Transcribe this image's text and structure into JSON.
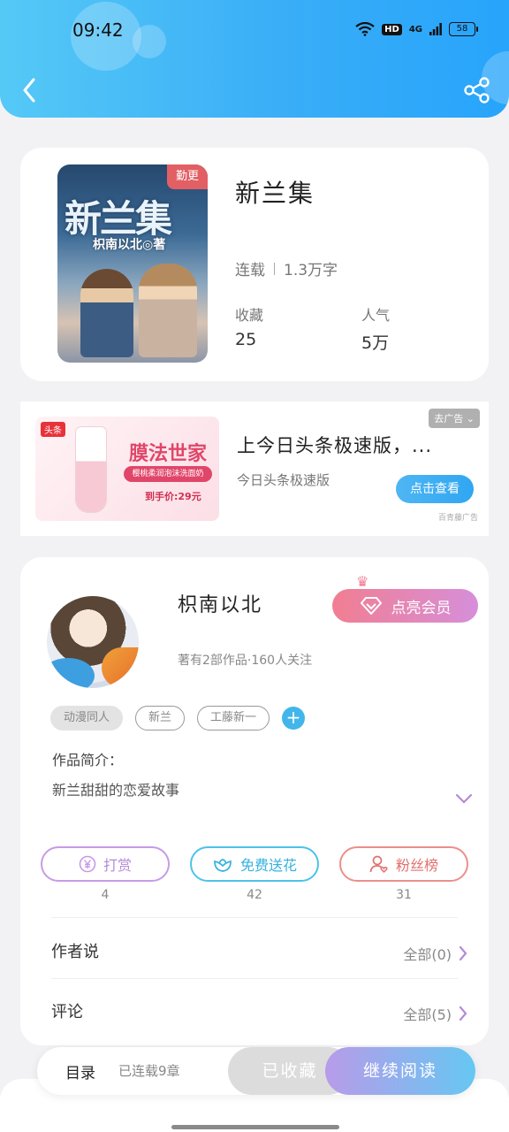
{
  "status_bar": {
    "time": "09:42",
    "hd": "HD",
    "network": "4G",
    "battery": "58"
  },
  "book": {
    "cover_title": "新兰集",
    "cover_author": "枳南以北◎著",
    "update_tag": "勤更",
    "title": "新兰集",
    "status": "连载",
    "word_count": "1.3万字",
    "collect_label": "收藏",
    "collect_value": "25",
    "popularity_label": "人气",
    "popularity_value": "5万"
  },
  "ad": {
    "image_brand": "头条",
    "image_name": "膜法世家",
    "image_sub": "樱桃柔润泡沫洗面奶",
    "image_price": "到手价:29元",
    "close_label": "去广告",
    "title": "上今日头条极速版，...",
    "desc": "今日头条极速版",
    "cta": "点击查看",
    "source": "百青藤广告"
  },
  "author": {
    "name": "枳南以北",
    "meta": "著有2部作品·160人关注",
    "vip_label": "点亮会员",
    "tags": [
      "动漫同人",
      "新兰",
      "工藤新一"
    ],
    "tag_add": "+",
    "intro_label": "作品简介：",
    "intro_text": "新兰甜甜的恋爱故事"
  },
  "actions": {
    "tip_label": "打赏",
    "tip_count": "4",
    "flower_label": "免费送花",
    "flower_count": "42",
    "fans_label": "粉丝榜",
    "fans_count": "31"
  },
  "rows": {
    "author_say_label": "作者说",
    "author_say_link": "全部(0)",
    "comments_label": "评论",
    "comments_link": "全部(5)"
  },
  "bottom": {
    "toc_label": "目录",
    "toc_count": "已连载9章",
    "collected_label": "已收藏",
    "read_label": "继续阅读"
  },
  "colors": {
    "header": "#3aaef7",
    "accent": "#42b6ea",
    "vip": "#f17e92"
  }
}
